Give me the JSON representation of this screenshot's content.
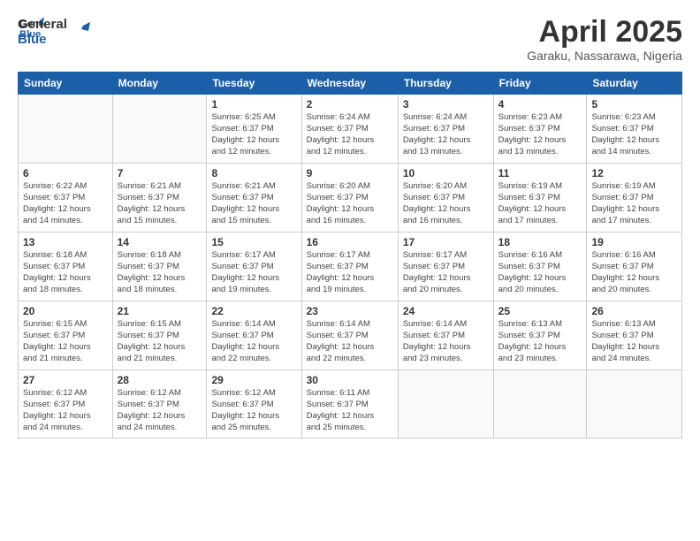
{
  "header": {
    "logo_line1": "General",
    "logo_line2": "Blue",
    "month": "April 2025",
    "location": "Garaku, Nassarawa, Nigeria"
  },
  "weekdays": [
    "Sunday",
    "Monday",
    "Tuesday",
    "Wednesday",
    "Thursday",
    "Friday",
    "Saturday"
  ],
  "weeks": [
    [
      {
        "day": "",
        "detail": ""
      },
      {
        "day": "",
        "detail": ""
      },
      {
        "day": "1",
        "detail": "Sunrise: 6:25 AM\nSunset: 6:37 PM\nDaylight: 12 hours\nand 12 minutes."
      },
      {
        "day": "2",
        "detail": "Sunrise: 6:24 AM\nSunset: 6:37 PM\nDaylight: 12 hours\nand 12 minutes."
      },
      {
        "day": "3",
        "detail": "Sunrise: 6:24 AM\nSunset: 6:37 PM\nDaylight: 12 hours\nand 13 minutes."
      },
      {
        "day": "4",
        "detail": "Sunrise: 6:23 AM\nSunset: 6:37 PM\nDaylight: 12 hours\nand 13 minutes."
      },
      {
        "day": "5",
        "detail": "Sunrise: 6:23 AM\nSunset: 6:37 PM\nDaylight: 12 hours\nand 14 minutes."
      }
    ],
    [
      {
        "day": "6",
        "detail": "Sunrise: 6:22 AM\nSunset: 6:37 PM\nDaylight: 12 hours\nand 14 minutes."
      },
      {
        "day": "7",
        "detail": "Sunrise: 6:21 AM\nSunset: 6:37 PM\nDaylight: 12 hours\nand 15 minutes."
      },
      {
        "day": "8",
        "detail": "Sunrise: 6:21 AM\nSunset: 6:37 PM\nDaylight: 12 hours\nand 15 minutes."
      },
      {
        "day": "9",
        "detail": "Sunrise: 6:20 AM\nSunset: 6:37 PM\nDaylight: 12 hours\nand 16 minutes."
      },
      {
        "day": "10",
        "detail": "Sunrise: 6:20 AM\nSunset: 6:37 PM\nDaylight: 12 hours\nand 16 minutes."
      },
      {
        "day": "11",
        "detail": "Sunrise: 6:19 AM\nSunset: 6:37 PM\nDaylight: 12 hours\nand 17 minutes."
      },
      {
        "day": "12",
        "detail": "Sunrise: 6:19 AM\nSunset: 6:37 PM\nDaylight: 12 hours\nand 17 minutes."
      }
    ],
    [
      {
        "day": "13",
        "detail": "Sunrise: 6:18 AM\nSunset: 6:37 PM\nDaylight: 12 hours\nand 18 minutes."
      },
      {
        "day": "14",
        "detail": "Sunrise: 6:18 AM\nSunset: 6:37 PM\nDaylight: 12 hours\nand 18 minutes."
      },
      {
        "day": "15",
        "detail": "Sunrise: 6:17 AM\nSunset: 6:37 PM\nDaylight: 12 hours\nand 19 minutes."
      },
      {
        "day": "16",
        "detail": "Sunrise: 6:17 AM\nSunset: 6:37 PM\nDaylight: 12 hours\nand 19 minutes."
      },
      {
        "day": "17",
        "detail": "Sunrise: 6:17 AM\nSunset: 6:37 PM\nDaylight: 12 hours\nand 20 minutes."
      },
      {
        "day": "18",
        "detail": "Sunrise: 6:16 AM\nSunset: 6:37 PM\nDaylight: 12 hours\nand 20 minutes."
      },
      {
        "day": "19",
        "detail": "Sunrise: 6:16 AM\nSunset: 6:37 PM\nDaylight: 12 hours\nand 20 minutes."
      }
    ],
    [
      {
        "day": "20",
        "detail": "Sunrise: 6:15 AM\nSunset: 6:37 PM\nDaylight: 12 hours\nand 21 minutes."
      },
      {
        "day": "21",
        "detail": "Sunrise: 6:15 AM\nSunset: 6:37 PM\nDaylight: 12 hours\nand 21 minutes."
      },
      {
        "day": "22",
        "detail": "Sunrise: 6:14 AM\nSunset: 6:37 PM\nDaylight: 12 hours\nand 22 minutes."
      },
      {
        "day": "23",
        "detail": "Sunrise: 6:14 AM\nSunset: 6:37 PM\nDaylight: 12 hours\nand 22 minutes."
      },
      {
        "day": "24",
        "detail": "Sunrise: 6:14 AM\nSunset: 6:37 PM\nDaylight: 12 hours\nand 23 minutes."
      },
      {
        "day": "25",
        "detail": "Sunrise: 6:13 AM\nSunset: 6:37 PM\nDaylight: 12 hours\nand 23 minutes."
      },
      {
        "day": "26",
        "detail": "Sunrise: 6:13 AM\nSunset: 6:37 PM\nDaylight: 12 hours\nand 24 minutes."
      }
    ],
    [
      {
        "day": "27",
        "detail": "Sunrise: 6:12 AM\nSunset: 6:37 PM\nDaylight: 12 hours\nand 24 minutes."
      },
      {
        "day": "28",
        "detail": "Sunrise: 6:12 AM\nSunset: 6:37 PM\nDaylight: 12 hours\nand 24 minutes."
      },
      {
        "day": "29",
        "detail": "Sunrise: 6:12 AM\nSunset: 6:37 PM\nDaylight: 12 hours\nand 25 minutes."
      },
      {
        "day": "30",
        "detail": "Sunrise: 6:11 AM\nSunset: 6:37 PM\nDaylight: 12 hours\nand 25 minutes."
      },
      {
        "day": "",
        "detail": ""
      },
      {
        "day": "",
        "detail": ""
      },
      {
        "day": "",
        "detail": ""
      }
    ]
  ]
}
